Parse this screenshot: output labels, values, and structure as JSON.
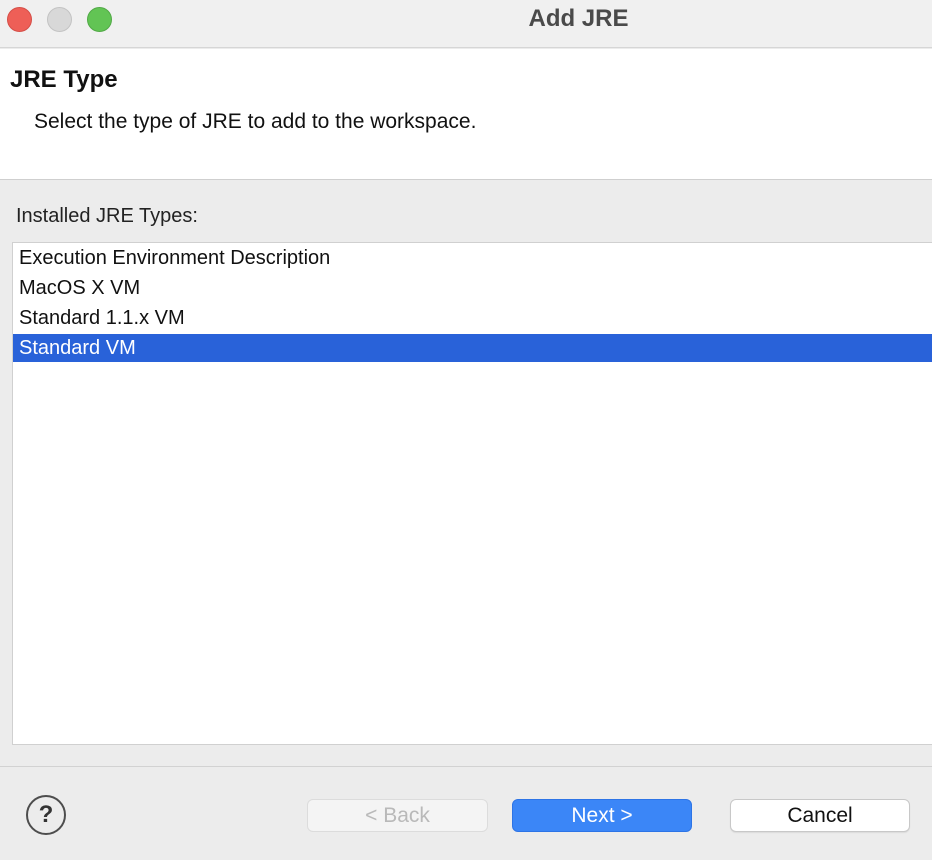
{
  "window": {
    "title": "Add JRE",
    "controls": [
      "close-button",
      "minimize-button",
      "zoom-button"
    ]
  },
  "header": {
    "title": "JRE Type",
    "description": "Select the type of JRE to add to the workspace."
  },
  "list": {
    "label": "Installed JRE Types:",
    "items": [
      {
        "label": "Execution Environment Description",
        "selected": false
      },
      {
        "label": "MacOS X VM",
        "selected": false
      },
      {
        "label": "Standard 1.1.x VM",
        "selected": false
      },
      {
        "label": "Standard VM",
        "selected": true
      }
    ],
    "selection_color": "#2962d9"
  },
  "footer": {
    "help_icon": "question-mark-icon",
    "help_glyph": "?",
    "back_label": "< Back",
    "back_enabled": false,
    "next_label": "Next >",
    "cancel_label": "Cancel",
    "accent_color": "#3b86f7"
  }
}
